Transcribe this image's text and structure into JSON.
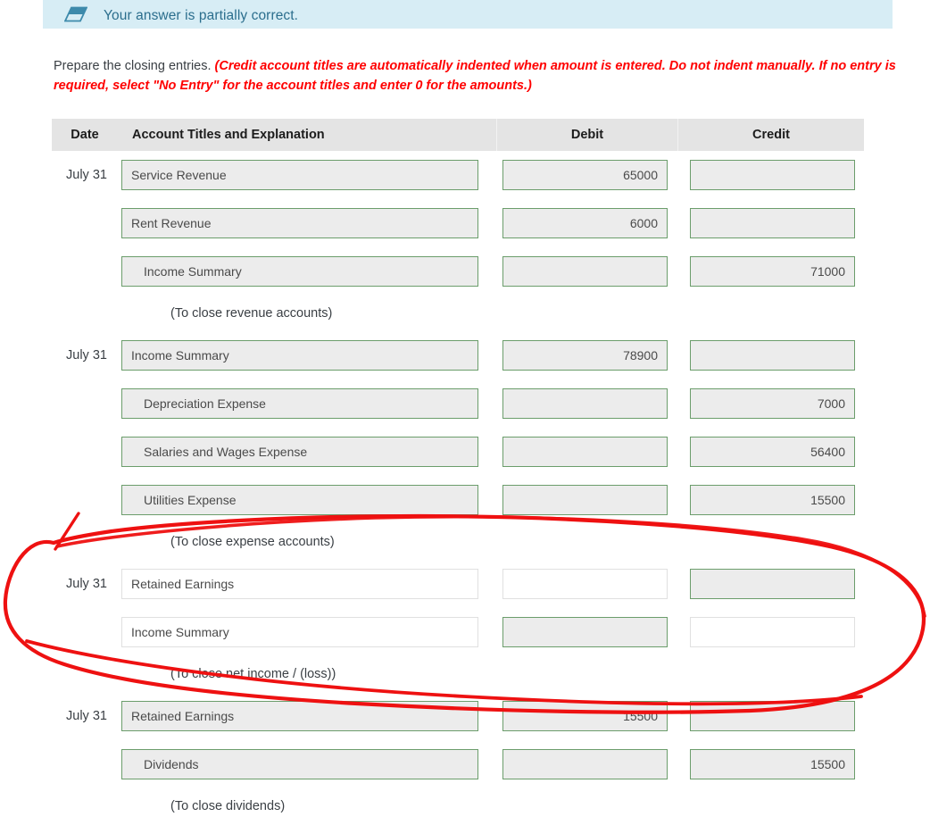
{
  "alert": {
    "icon": "eraser-icon",
    "message": "Your answer is partially correct.",
    "bg_color": "#d7edf5",
    "text_color": "#2b6e8d"
  },
  "instructions": {
    "lead": "Prepare the closing entries. ",
    "requirement": "(Credit account titles are automatically indented when amount is entered. Do not indent manually. If no entry is required, select \"No Entry\" for the account titles and enter 0 for the amounts.)",
    "requirement_color": "#ff0000"
  },
  "table": {
    "headers": {
      "date": "Date",
      "account": "Account Titles and Explanation",
      "debit": "Debit",
      "credit": "Credit"
    },
    "header_bg": "#e4e4e4",
    "field_border_filled": "#6b9d6b",
    "field_bg_filled": "#ececec",
    "field_border_blank": "#e0e0e0",
    "field_bg_blank": "#ffffff",
    "entries": [
      {
        "date": "July 31",
        "lines": [
          {
            "account": "Service Revenue",
            "indent": false,
            "debit": "65000",
            "credit": "",
            "account_state": "filled",
            "debit_state": "filled",
            "credit_state": "filled"
          },
          {
            "account": "Rent Revenue",
            "indent": false,
            "debit": "6000",
            "credit": "",
            "account_state": "filled",
            "debit_state": "filled",
            "credit_state": "filled"
          },
          {
            "account": "Income Summary",
            "indent": true,
            "debit": "",
            "credit": "71000",
            "account_state": "filled",
            "debit_state": "filled",
            "credit_state": "filled"
          }
        ],
        "memo": "(To close revenue accounts)"
      },
      {
        "date": "July 31",
        "lines": [
          {
            "account": "Income Summary",
            "indent": false,
            "debit": "78900",
            "credit": "",
            "account_state": "filled",
            "debit_state": "filled",
            "credit_state": "filled"
          },
          {
            "account": "Depreciation Expense",
            "indent": true,
            "debit": "",
            "credit": "7000",
            "account_state": "filled",
            "debit_state": "filled",
            "credit_state": "filled"
          },
          {
            "account": "Salaries and Wages Expense",
            "indent": true,
            "debit": "",
            "credit": "56400",
            "account_state": "filled",
            "debit_state": "filled",
            "credit_state": "filled"
          },
          {
            "account": "Utilities Expense",
            "indent": true,
            "debit": "",
            "credit": "15500",
            "account_state": "filled",
            "debit_state": "filled",
            "credit_state": "filled"
          }
        ],
        "memo": "(To close expense accounts)"
      },
      {
        "date": "July 31",
        "lines": [
          {
            "account": "Retained Earnings",
            "indent": false,
            "debit": "",
            "credit": "",
            "account_state": "blank",
            "debit_state": "blank",
            "credit_state": "filled"
          },
          {
            "account": "Income Summary",
            "indent": false,
            "debit": "",
            "credit": "",
            "account_state": "blank",
            "debit_state": "filled",
            "credit_state": "blank"
          }
        ],
        "memo": "(To close net income / (loss))"
      },
      {
        "date": "July 31",
        "lines": [
          {
            "account": "Retained Earnings",
            "indent": false,
            "debit": "15500",
            "credit": "",
            "account_state": "filled",
            "debit_state": "filled",
            "credit_state": "filled"
          },
          {
            "account": "Dividends",
            "indent": true,
            "debit": "",
            "credit": "15500",
            "account_state": "filled",
            "debit_state": "filled",
            "credit_state": "filled"
          }
        ],
        "memo": "(To close dividends)"
      }
    ]
  },
  "annotation": {
    "type": "hand-drawn-red-ellipse",
    "color": "#ee1111",
    "description": "Red hand-drawn ellipse circling the third journal entry (To close net income / (loss))"
  }
}
